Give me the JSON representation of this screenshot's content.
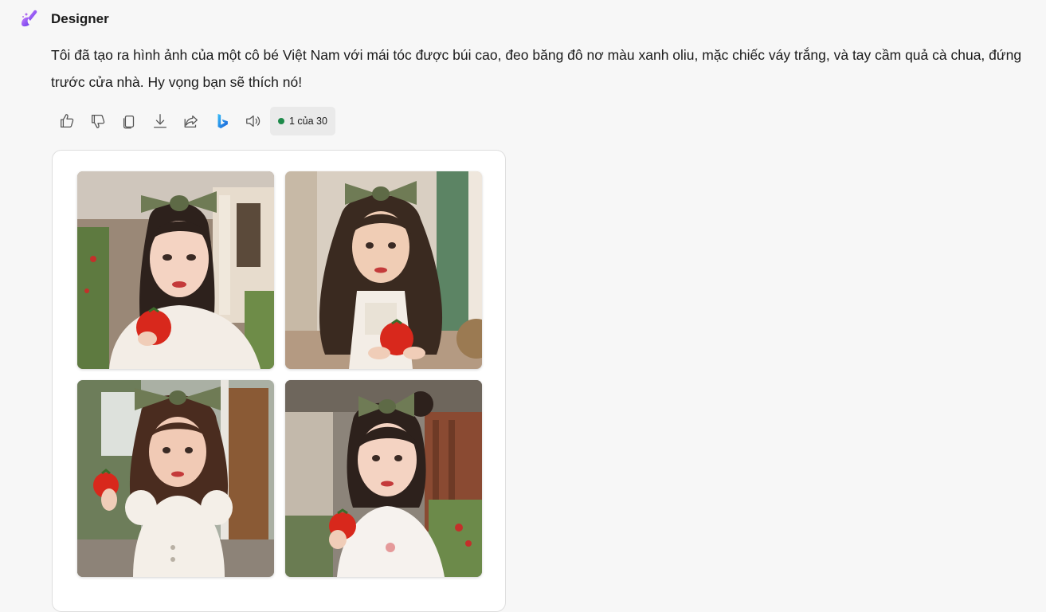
{
  "message": {
    "sender": "Designer",
    "logo_icon": "designer-logo-icon",
    "text": "Tôi đã tạo ra hình ảnh của một cô bé Việt Nam với mái tóc được búi cao, đeo băng đô nơ màu xanh oliu, mặc chiếc váy trắng, và tay cầm quả cà chua, đứng trước cửa nhà. Hy vọng bạn sẽ thích nó!"
  },
  "actions": {
    "icons": [
      "thumbs-up-icon",
      "thumbs-down-icon",
      "copy-icon",
      "download-icon",
      "share-icon",
      "bing-icon",
      "speaker-icon"
    ],
    "counter": "1 của 30",
    "counter_dot_color": "#1d8a4a"
  },
  "images": {
    "count": 4,
    "bow_color": "#6f7b55",
    "tomato_color": "#d8281c"
  },
  "colors": {
    "background": "#f7f7f7",
    "card": "#ffffff",
    "accent_logo": "#9b4de0"
  }
}
